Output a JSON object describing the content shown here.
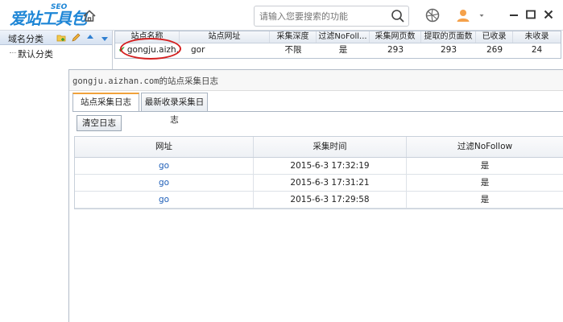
{
  "header": {
    "logo_text": "爱站工具包",
    "logo_sub": "SEO",
    "search_placeholder": "请输入您要搜索的功能"
  },
  "sidebar": {
    "title": "域名分类",
    "items": [
      {
        "label": "默认分类"
      }
    ]
  },
  "site_table": {
    "columns": [
      "站点名称",
      "站点网址",
      "采集深度",
      "过滤NoFoll...",
      "采集网页数",
      "提取的页面数",
      "已收录",
      "未收录"
    ],
    "rows": [
      [
        "gongju.aizh...",
        "gor",
        "不限",
        "是",
        "293",
        "293",
        "269",
        "24"
      ]
    ]
  },
  "log_panel": {
    "title": "gongju.aizhan.com的站点采集日志",
    "tabs": [
      "站点采集日志",
      "最新收录采集日志"
    ],
    "clear_button": "清空日志",
    "columns": [
      "网址",
      "采集时间",
      "过滤NoFollow"
    ],
    "rows": [
      [
        "go",
        "2015-6-3 17:32:19",
        "是"
      ],
      [
        "go",
        "2015-6-3 17:31:21",
        "是"
      ],
      [
        "go",
        "2015-6-3 17:29:58",
        "是"
      ]
    ]
  },
  "colors": {
    "brand": "#1e86d6",
    "link": "#1f5fb8",
    "annotation": "#d42020",
    "tab_accent": "#f0a23a"
  }
}
